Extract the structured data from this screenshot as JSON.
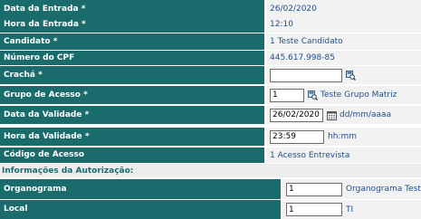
{
  "fields": {
    "data_entrada": {
      "label": "Data da Entrada *",
      "value": "26/02/2020"
    },
    "hora_entrada": {
      "label": "Hora da Entrada *",
      "value": "12:10"
    },
    "candidato": {
      "label": "Candidato *",
      "value": "1 Teste Candidato"
    },
    "cpf": {
      "label": "Número do CPF",
      "value": "445.617.998-85"
    },
    "cracha": {
      "label": "Crachá *",
      "value": ""
    },
    "grupo_acesso": {
      "label": "Grupo de Acesso *",
      "value": "1",
      "description": "Teste Grupo Matriz"
    },
    "data_validade": {
      "label": "Data da Validade *",
      "value": "26/02/2020",
      "hint": "dd/mm/aaaa"
    },
    "hora_validade": {
      "label": "Hora da Validade *",
      "value": "23:59",
      "hint": "hh:mm"
    },
    "codigo_acesso": {
      "label": "Código de Acesso",
      "value": "1 Acesso Entrevista"
    }
  },
  "section": {
    "title": "Informações da Autorização:"
  },
  "autorizacao": {
    "organograma": {
      "label": "Organograma",
      "value": "1",
      "description": "Organograma Teste"
    },
    "local": {
      "label": "Local",
      "value": "1",
      "description": "TI"
    }
  },
  "colors": {
    "label_bg": "#1a6c6c",
    "value_bg": "#f2f2f2",
    "link_text": "#1f4f8f"
  }
}
